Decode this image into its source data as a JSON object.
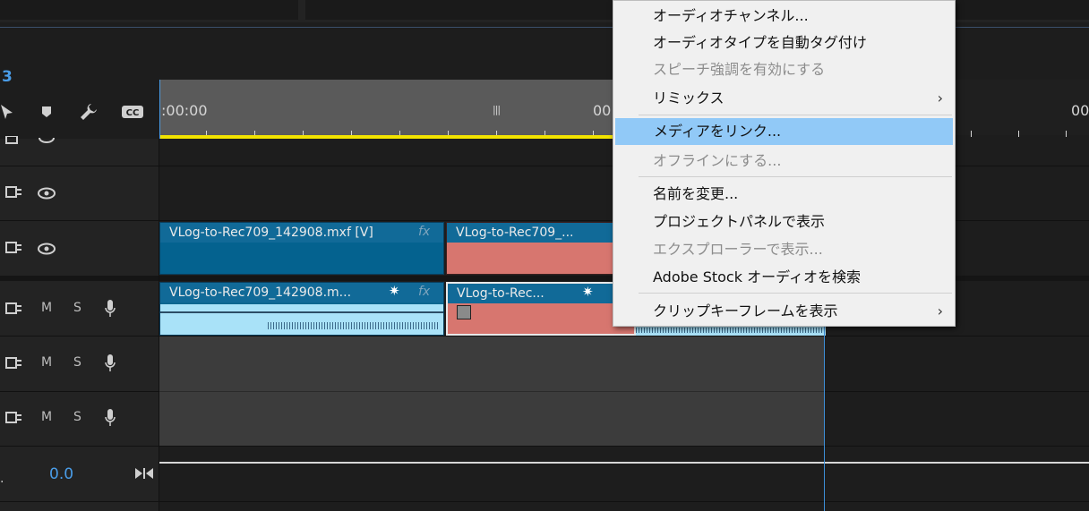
{
  "timeline": {
    "sequence_number": "3",
    "ruler": {
      "start_timecode": ":00:00",
      "mid_timecode": "00",
      "right_timecode": "00"
    },
    "audio_letters": {
      "mute": "M",
      "solo": "S"
    },
    "master_value": "0.0",
    "clips": {
      "v1_a": {
        "name": "VLog-to-Rec709_142908.mxf [V]",
        "fx": "fx"
      },
      "v1_b": {
        "name": "VLog-to-Rec709_..."
      },
      "a1_a": {
        "name": "VLog-to-Rec709_142908.m...",
        "fx": "fx"
      },
      "a1_b": {
        "name": "VLog-to-Rec..."
      }
    }
  },
  "context_menu": {
    "items": [
      {
        "label": "オーディオチャンネル...",
        "disabled": false
      },
      {
        "label": "オーディオタイプを自動タグ付け",
        "disabled": false
      },
      {
        "label": "スピーチ強調を有効にする",
        "disabled": true
      },
      {
        "label": "リミックス",
        "disabled": false,
        "submenu": true
      },
      {
        "label": "メディアをリンク...",
        "disabled": false,
        "highlighted": true
      },
      {
        "label": "オフラインにする...",
        "disabled": true
      },
      {
        "label": "名前を変更...",
        "disabled": false
      },
      {
        "label": "プロジェクトパネルで表示",
        "disabled": false
      },
      {
        "label": "エクスプローラーで表示...",
        "disabled": true
      },
      {
        "label": "Adobe Stock オーディオを検索",
        "disabled": false
      },
      {
        "label": "クリップキーフレームを表示",
        "disabled": false,
        "submenu": true
      }
    ]
  },
  "colors": {
    "accent_blue": "#4a9de8",
    "clip_blue": "#04628f",
    "clip_red": "#d7766f",
    "playhead_yellow": "#f2e300",
    "menu_highlight": "#91c9f7"
  }
}
